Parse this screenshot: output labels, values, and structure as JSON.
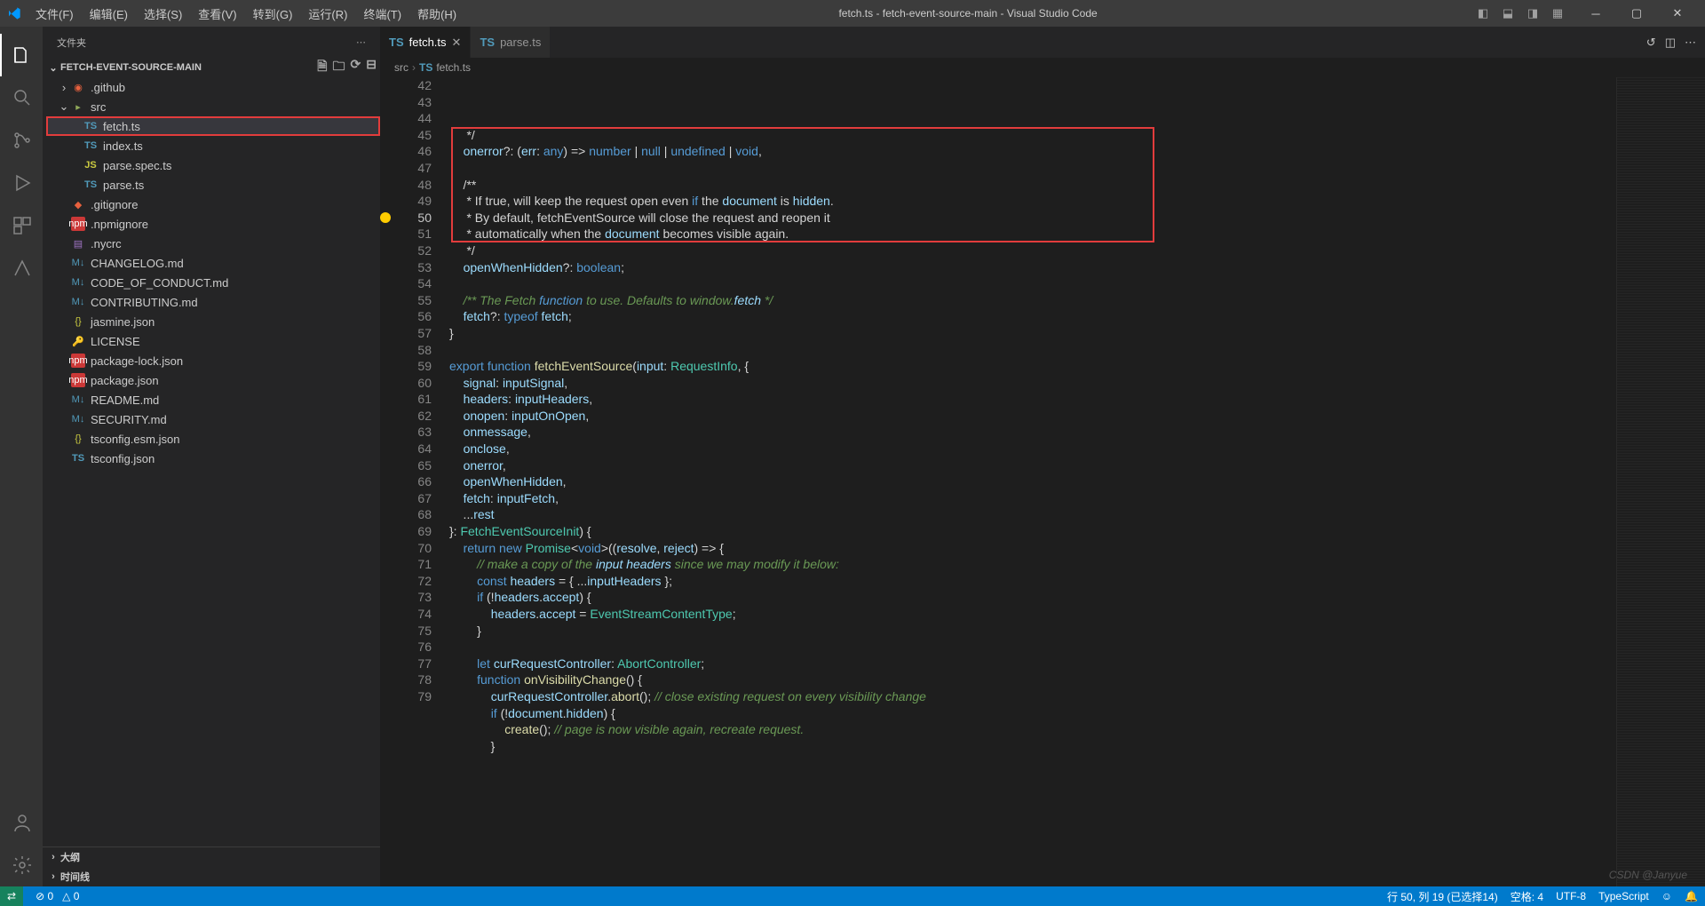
{
  "window": {
    "title": "fetch.ts - fetch-event-source-main - Visual Studio Code"
  },
  "menubar": [
    "文件(F)",
    "编辑(E)",
    "选择(S)",
    "查看(V)",
    "转到(G)",
    "运行(R)",
    "终端(T)",
    "帮助(H)"
  ],
  "sidebar": {
    "title": "文件夹",
    "section_label": "FETCH-EVENT-SOURCE-MAIN",
    "outline_label": "大纲",
    "timeline_label": "时间线"
  },
  "tree": [
    {
      "depth": 0,
      "twisty": "›",
      "icon": "github",
      "label": ".github"
    },
    {
      "depth": 0,
      "twisty": "⌄",
      "icon": "folder",
      "label": "src"
    },
    {
      "depth": 1,
      "twisty": "",
      "icon": "ts",
      "label": "fetch.ts",
      "highlighted": true,
      "selected": true
    },
    {
      "depth": 1,
      "twisty": "",
      "icon": "ts",
      "label": "index.ts"
    },
    {
      "depth": 1,
      "twisty": "",
      "icon": "js",
      "label": "parse.spec.ts"
    },
    {
      "depth": 1,
      "twisty": "",
      "icon": "ts",
      "label": "parse.ts"
    },
    {
      "depth": 0,
      "twisty": "",
      "icon": "git",
      "label": ".gitignore"
    },
    {
      "depth": 0,
      "twisty": "",
      "icon": "npm",
      "label": ".npmignore"
    },
    {
      "depth": 0,
      "twisty": "",
      "icon": "yaml",
      "label": ".nycrc"
    },
    {
      "depth": 0,
      "twisty": "",
      "icon": "md",
      "label": "CHANGELOG.md"
    },
    {
      "depth": 0,
      "twisty": "",
      "icon": "md",
      "label": "CODE_OF_CONDUCT.md"
    },
    {
      "depth": 0,
      "twisty": "",
      "icon": "md",
      "label": "CONTRIBUTING.md"
    },
    {
      "depth": 0,
      "twisty": "",
      "icon": "json",
      "label": "jasmine.json"
    },
    {
      "depth": 0,
      "twisty": "",
      "icon": "license",
      "label": "LICENSE"
    },
    {
      "depth": 0,
      "twisty": "",
      "icon": "npm",
      "label": "package-lock.json"
    },
    {
      "depth": 0,
      "twisty": "",
      "icon": "npm",
      "label": "package.json"
    },
    {
      "depth": 0,
      "twisty": "",
      "icon": "md",
      "label": "README.md"
    },
    {
      "depth": 0,
      "twisty": "",
      "icon": "md",
      "label": "SECURITY.md"
    },
    {
      "depth": 0,
      "twisty": "",
      "icon": "json",
      "label": "tsconfig.esm.json"
    },
    {
      "depth": 0,
      "twisty": "",
      "icon": "ts",
      "label": "tsconfig.json"
    }
  ],
  "tabs": [
    {
      "icon": "ts",
      "label": "fetch.ts",
      "active": true
    },
    {
      "icon": "ts",
      "label": "parse.ts",
      "active": false
    }
  ],
  "breadcrumbs": [
    "src",
    "fetch.ts"
  ],
  "code": {
    "first_line": 42,
    "current_line": 50,
    "lines": [
      "     */",
      "    onerror?: (err: any) => number | null | undefined | void,",
      "",
      "    /**",
      "     * If true, will keep the request open even if the document is hidden.",
      "     * By default, fetchEventSource will close the request and reopen it",
      "     * automatically when the document becomes visible again.",
      "     */",
      "    openWhenHidden?: boolean;",
      "",
      "    /** The Fetch function to use. Defaults to window.fetch */",
      "    fetch?: typeof fetch;",
      "}",
      "",
      "export function fetchEventSource(input: RequestInfo, {",
      "    signal: inputSignal,",
      "    headers: inputHeaders,",
      "    onopen: inputOnOpen,",
      "    onmessage,",
      "    onclose,",
      "    onerror,",
      "    openWhenHidden,",
      "    fetch: inputFetch,",
      "    ...rest",
      "}: FetchEventSourceInit) {",
      "    return new Promise<void>((resolve, reject) => {",
      "        // make a copy of the input headers since we may modify it below:",
      "        const headers = { ...inputHeaders };",
      "        if (!headers.accept) {",
      "            headers.accept = EventStreamContentType;",
      "        }",
      "",
      "        let curRequestController: AbortController;",
      "        function onVisibilityChange() {",
      "            curRequestController.abort(); // close existing request on every visibility change",
      "            if (!document.hidden) {",
      "                create(); // page is now visible again, recreate request.",
      "            }"
    ]
  },
  "statusbar": {
    "remote": "⇄",
    "errors": "⊘ 0",
    "warnings": "△ 0",
    "cursor": "行 50, 列 19 (已选择14)",
    "spaces": "空格: 4",
    "encoding": "UTF-8",
    "language": "TypeScript",
    "feedback": "☺",
    "notifications": "🔔"
  },
  "watermark": "CSDN @Janyue"
}
